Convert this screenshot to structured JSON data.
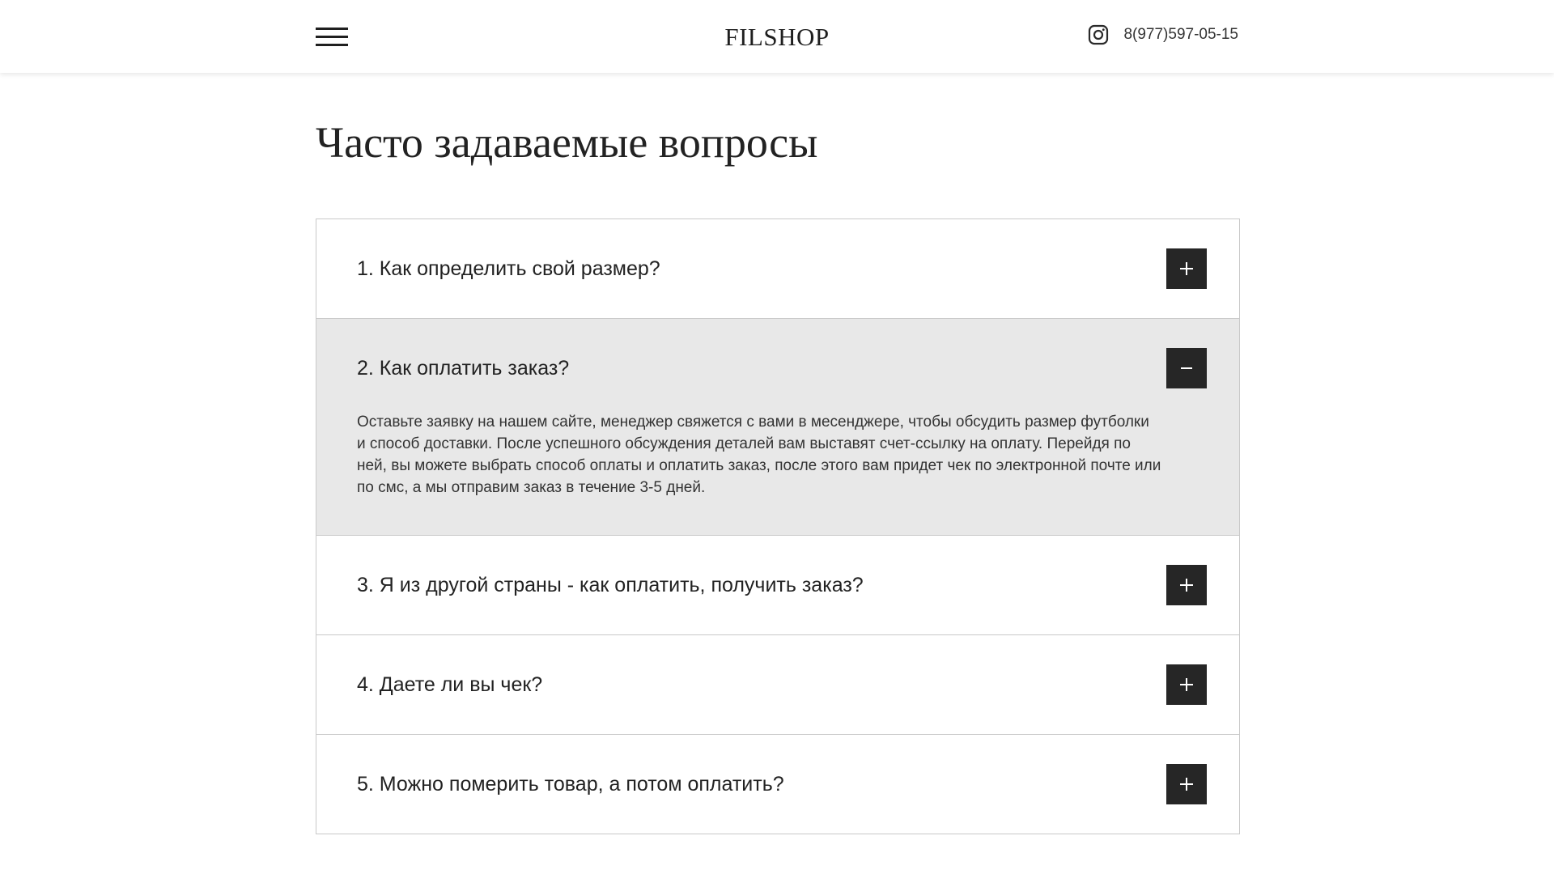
{
  "header": {
    "logo": "FILSHOP",
    "phone": "8(977)597-05-15",
    "menu_icon": "hamburger-menu-icon",
    "social_icon": "instagram-icon"
  },
  "main": {
    "title": "Часто задаваемые вопросы"
  },
  "faq": [
    {
      "question": "1. Как определить свой размер?",
      "expanded": false,
      "toggle_icon": "plus-icon"
    },
    {
      "question": "2. Как оплатить заказ?",
      "expanded": true,
      "toggle_icon": "minus-icon",
      "answer": "Оставьте заявку на нашем сайте, менеджер свяжется с вами в месенджере, чтобы обсудить размер футболки и способ доставки. После успешного обсуждения деталей вам выставят счет-ссылку на оплату. Перейдя по ней, вы можете выбрать способ оплаты и оплатить заказ, после этого вам придет чек по электронной почте или по смс, а мы отправим заказ в течение 3-5 дней."
    },
    {
      "question": "3. Я из другой страны - как оплатить, получить заказ?",
      "expanded": false,
      "toggle_icon": "plus-icon"
    },
    {
      "question": "4. Даете ли вы чек?",
      "expanded": false,
      "toggle_icon": "plus-icon"
    },
    {
      "question": "5. Можно померить товар, а потом оплатить?",
      "expanded": false,
      "toggle_icon": "plus-icon"
    }
  ],
  "colors": {
    "toggle_bg": "#262626",
    "expanded_bg": "#e8e8e8",
    "border": "#c9c9c9"
  }
}
